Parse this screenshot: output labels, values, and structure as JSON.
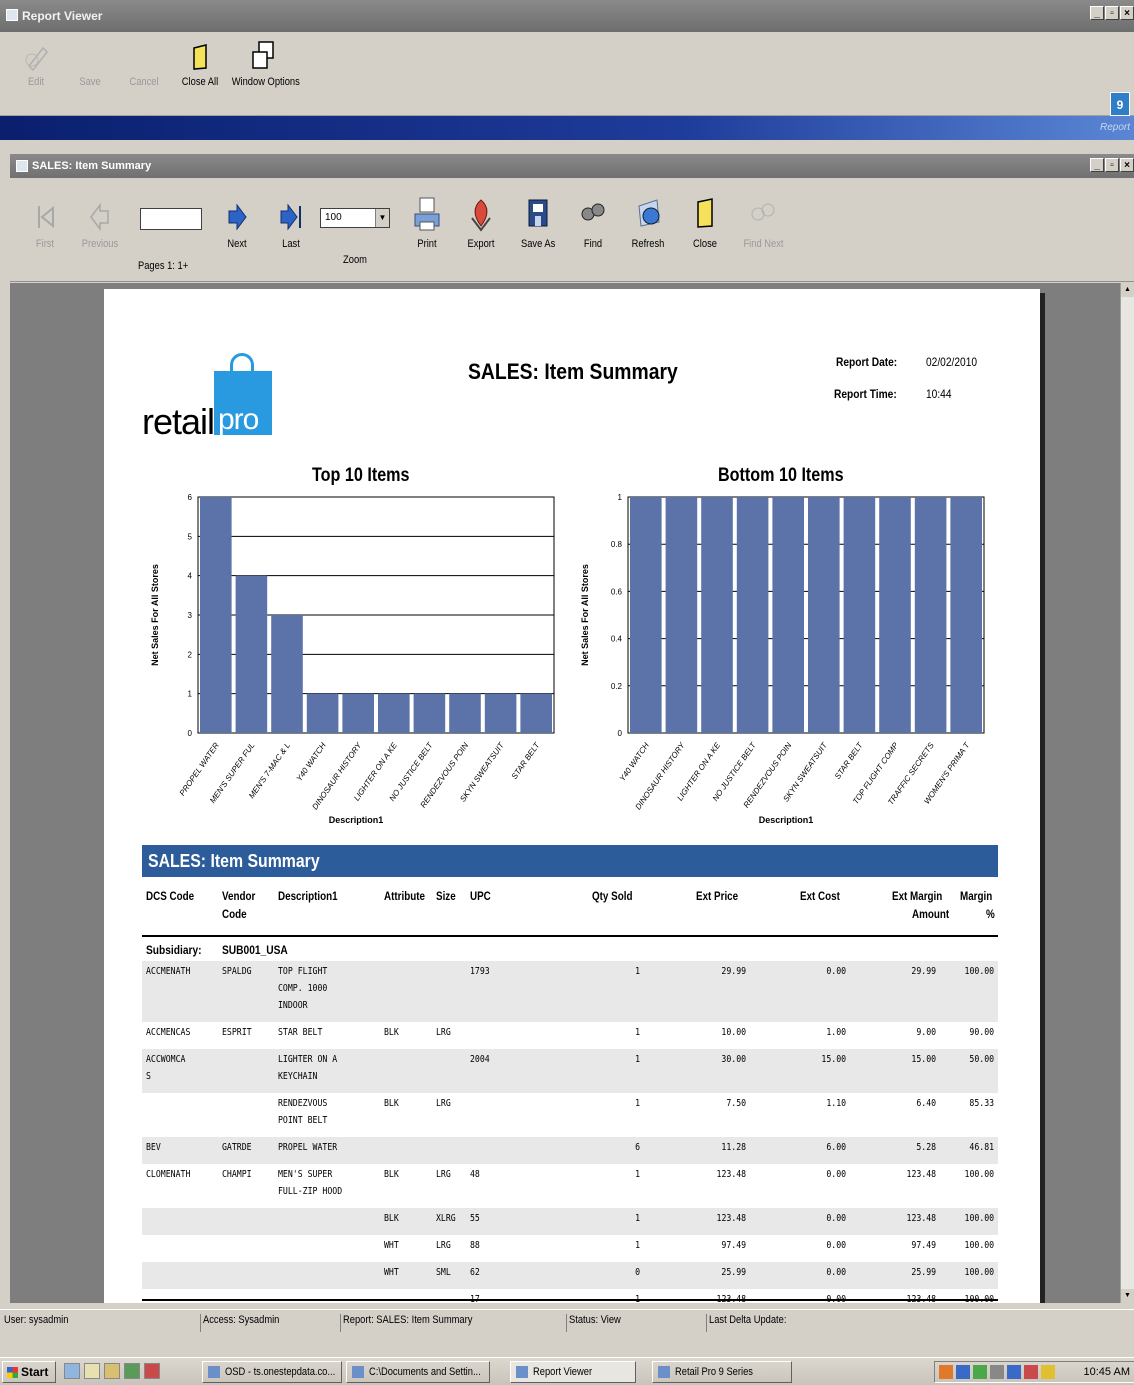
{
  "window": {
    "title": "Report Viewer"
  },
  "toolbar1": {
    "edit": "Edit",
    "save": "Save",
    "cancel": "Cancel",
    "close_all": "Close All",
    "window_options": "Window Options"
  },
  "banner_right": "Report",
  "corner_badge": "9",
  "subwindow": {
    "title": "SALES: Item Summary"
  },
  "toolbar2": {
    "first": "First",
    "previous": "Previous",
    "pages": "Pages 1: 1+",
    "next": "Next",
    "last": "Last",
    "zoom_value": "100",
    "zoom": "Zoom",
    "print": "Print",
    "export": "Export",
    "save_as": "Save As",
    "find": "Find",
    "refresh": "Refresh",
    "close": "Close",
    "find_next": "Find Next"
  },
  "report": {
    "title": "SALES: Item Summary",
    "logo_text_1": "retail",
    "logo_text_2": "pro",
    "report_date_label": "Report Date:",
    "report_date": "02/02/2010",
    "report_time_label": "Report Time:",
    "report_time": "10:44",
    "section_title": "SALES: Item Summary",
    "subsidiary_label": "Subsidiary:",
    "subsidiary": "SUB001_USA",
    "headers": {
      "dcs": "DCS Code",
      "vendor1": "Vendor",
      "vendor2": "Code",
      "desc": "Description1",
      "attr": "Attribute",
      "size": "Size",
      "upc": "UPC",
      "qty": "Qty Sold",
      "price": "Ext Price",
      "cost": "Ext Cost",
      "margin_amt1": "Ext Margin",
      "margin_amt2": "Amount",
      "margin_pct1": "Margin",
      "margin_pct2": "%"
    },
    "rows": [
      {
        "dcs": "ACCMENATH",
        "vendor": "SPALDG",
        "desc": "TOP FLIGHT\nCOMP. 1000\nINDOOR",
        "attr": "",
        "size": "",
        "upc": "1793",
        "qty": "1",
        "price": "29.99",
        "cost": "0.00",
        "margin": "29.99",
        "pct": "100.00"
      },
      {
        "dcs": "ACCMENCAS",
        "vendor": "ESPRIT",
        "desc": "STAR BELT",
        "attr": "BLK",
        "size": "LRG",
        "upc": "",
        "qty": "1",
        "price": "10.00",
        "cost": "1.00",
        "margin": "9.00",
        "pct": "90.00"
      },
      {
        "dcs": "ACCWOMCA\nS",
        "vendor": "",
        "desc": "LIGHTER ON A\nKEYCHAIN",
        "attr": "",
        "size": "",
        "upc": "2004",
        "qty": "1",
        "price": "30.00",
        "cost": "15.00",
        "margin": "15.00",
        "pct": "50.00"
      },
      {
        "dcs": "",
        "vendor": "",
        "desc": "RENDEZVOUS\nPOINT BELT",
        "attr": "BLK",
        "size": "LRG",
        "upc": "",
        "qty": "1",
        "price": "7.50",
        "cost": "1.10",
        "margin": "6.40",
        "pct": "85.33"
      },
      {
        "dcs": "BEV",
        "vendor": "GATRDE",
        "desc": "PROPEL WATER",
        "attr": "",
        "size": "",
        "upc": "",
        "qty": "6",
        "price": "11.28",
        "cost": "6.00",
        "margin": "5.28",
        "pct": "46.81"
      },
      {
        "dcs": "CLOMENATH",
        "vendor": "CHAMPI",
        "desc": "MEN'S SUPER\nFULL-ZIP HOOD",
        "attr": "BLK",
        "size": "LRG",
        "upc": "48",
        "qty": "1",
        "price": "123.48",
        "cost": "0.00",
        "margin": "123.48",
        "pct": "100.00"
      },
      {
        "dcs": "",
        "vendor": "",
        "desc": "",
        "attr": "BLK",
        "size": "XLRG",
        "upc": "55",
        "qty": "1",
        "price": "123.48",
        "cost": "0.00",
        "margin": "123.48",
        "pct": "100.00"
      },
      {
        "dcs": "",
        "vendor": "",
        "desc": "",
        "attr": "WHT",
        "size": "LRG",
        "upc": "88",
        "qty": "1",
        "price": "97.49",
        "cost": "0.00",
        "margin": "97.49",
        "pct": "100.00"
      },
      {
        "dcs": "",
        "vendor": "",
        "desc": "",
        "attr": "WHT",
        "size": "SML",
        "upc": "62",
        "qty": "0",
        "price": "25.99",
        "cost": "0.00",
        "margin": "25.99",
        "pct": "100.00"
      },
      {
        "dcs": "",
        "vendor": "",
        "desc": "",
        "attr": "",
        "size": "",
        "upc": "17",
        "qty": "1",
        "price": "123.48",
        "cost": "0.00",
        "margin": "123.48",
        "pct": "100.00"
      }
    ]
  },
  "chart_data": [
    {
      "type": "bar",
      "title": "Top 10 Items",
      "xlabel": "Description1",
      "ylabel": "Net Sales For All Stores",
      "ylim": [
        0,
        6
      ],
      "yticks": [
        "0",
        "1",
        "2",
        "3",
        "4",
        "5",
        "6"
      ],
      "categories": [
        "PROPEL WATER",
        "MEN'S SUPER FUL",
        "MEN'S 7-MAC & L",
        "Y40 WATCH",
        "DINOSAUR HISTORY",
        "LIGHTER ON A KE",
        "NO JUSTICE BELT",
        "RENDEZVOUS POIN",
        "SKYN SWEATSUIT",
        "STAR BELT"
      ],
      "values": [
        6,
        4,
        3,
        1,
        1,
        1,
        1,
        1,
        1,
        1
      ],
      "color": "#5b73a8"
    },
    {
      "type": "bar",
      "title": "Bottom 10 Items",
      "xlabel": "Description1",
      "ylabel": "Net Sales For All Stores",
      "ylim": [
        0,
        1
      ],
      "yticks": [
        "0",
        "0.2",
        "0.4",
        "0.6",
        "0.8",
        "1"
      ],
      "categories": [
        "Y40 WATCH",
        "DINOSAUR HISTORY",
        "LIGHTER ON A KE",
        "NO JUSTICE BELT",
        "RENDEZVOUS POIN",
        "SKYN SWEATSUIT",
        "STAR BELT",
        "TOP FLIGHT COMP",
        "TRAFFIC SECRETS",
        "WOMEN'S PRIMA T"
      ],
      "values": [
        1,
        1,
        1,
        1,
        1,
        1,
        1,
        1,
        1,
        1
      ],
      "color": "#5b73a8"
    }
  ],
  "statusbar": {
    "user": "User: sysadmin",
    "access": "Access: Sysadmin",
    "report": "Report: SALES: Item Summary",
    "status": "Status: View",
    "delta": "Last Delta Update:"
  },
  "taskbar": {
    "start": "Start",
    "tasks": [
      "OSD - ts.onestepdata.co...",
      "C:\\Documents and Settin...",
      "Report Viewer",
      "Retail Pro 9 Series"
    ],
    "clock": "10:45 AM"
  }
}
